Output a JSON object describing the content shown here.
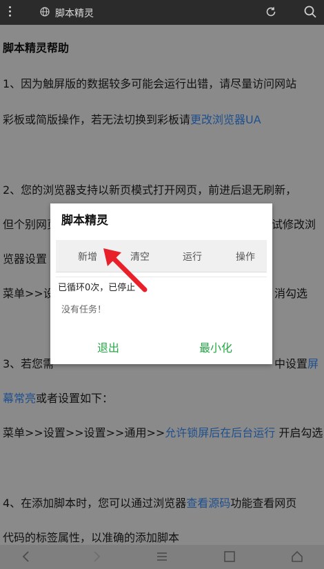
{
  "topbar": {
    "title": "脚本精灵"
  },
  "page": {
    "heading": "脚本精灵帮助",
    "p1_line1": "1、因为触屏版的数据较多可能会运行出错，请尽量访问网站",
    "p1_line2_a": "彩板或简版操作，若无法切换到彩板请",
    "p1_line2_link": "更改浏览器UA",
    "p2_line1": "2、您的浏览器支持以新页模式打开网页，前进后退无刷新，",
    "p2_line2_a": "但个别网页",
    "p2_line2_b": "试修改浏",
    "p2_line3_a": "览器设置",
    "p2_line4_a": "菜单>>设",
    "p2_line4_b": "消勾选",
    "p3_line1_a": "3、若您需",
    "p3_line1_b": "中设置",
    "p3_line1_link": "屏",
    "p3_line2_link": "幕常亮",
    "p3_line2_b": "或者设置如下：",
    "p3_line3_a": "菜单>>设置>>设置>>通用>>",
    "p3_line3_link": "允许锁屏后在后台运行",
    "p3_line3_b": " 开启勾选",
    "p4_line1_a": "4、在添加脚本时，您可以通过浏览器",
    "p4_line1_link": "查看源码",
    "p4_line1_b": "功能查看网页",
    "p4_line2": "代码的标签属性，以准确的添加脚本"
  },
  "dialog": {
    "title": "脚本精灵",
    "tabs": [
      "新增",
      "清空",
      "运行",
      "操作"
    ],
    "status": "已循环0次，已停止",
    "empty": "没有任务！",
    "exit_label": "退出",
    "minimize_label": "最小化"
  },
  "colors": {
    "accent": "#22aa44",
    "link": "#1f4f8c",
    "arrow": "#e8202a"
  }
}
